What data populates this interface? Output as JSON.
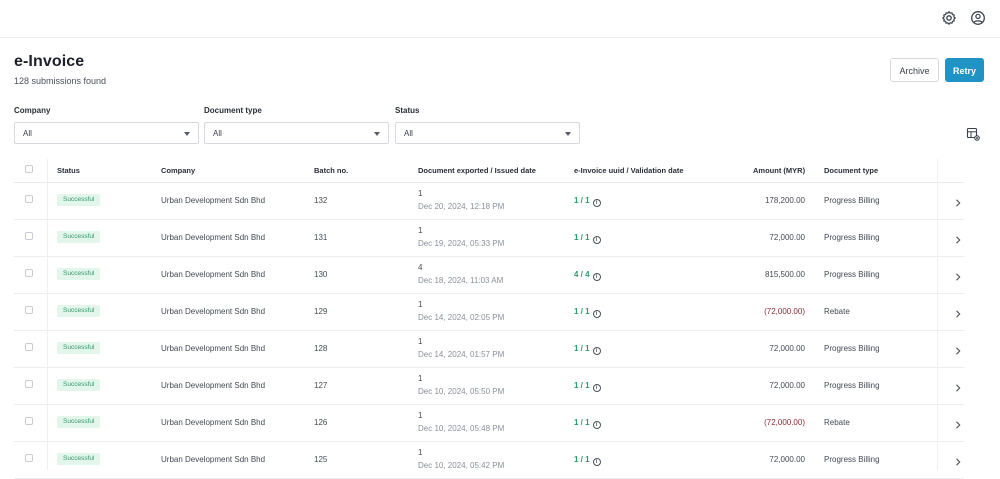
{
  "header": {
    "title": "e-Invoice",
    "subtitle": "128 submissions found",
    "archive_label": "Archive",
    "retry_label": "Retry",
    "accent_color": "#1f93c4"
  },
  "topbar": {
    "icons": [
      "gear-icon",
      "user-circle-icon"
    ]
  },
  "filters": {
    "company": {
      "label": "Company",
      "value": "All"
    },
    "document_type": {
      "label": "Document type",
      "value": "All"
    },
    "status": {
      "label": "Status",
      "value": "All"
    }
  },
  "table": {
    "columns": [
      "Status",
      "Company",
      "Batch no.",
      "Document exported / Issued date",
      "e-Invoice uuid / Validation date",
      "Amount (MYR)",
      "Document type"
    ],
    "rows": [
      {
        "status": "Successful",
        "company": "Urban Development Sdn Bhd",
        "batch": "132",
        "exported": "1",
        "date": "Dec 20, 2024, 12:18 PM",
        "uuid": "1 / 1",
        "amount": "178,200.00",
        "negative": false,
        "doc_type": "Progress Billing"
      },
      {
        "status": "Successful",
        "company": "Urban Development Sdn Bhd",
        "batch": "131",
        "exported": "1",
        "date": "Dec 19, 2024, 05:33 PM",
        "uuid": "1 / 1",
        "amount": "72,000.00",
        "negative": false,
        "doc_type": "Progress Billing"
      },
      {
        "status": "Successful",
        "company": "Urban Development Sdn Bhd",
        "batch": "130",
        "exported": "4",
        "date": "Dec 18, 2024, 11:03 AM",
        "uuid": "4 / 4",
        "amount": "815,500.00",
        "negative": false,
        "doc_type": "Progress Billing"
      },
      {
        "status": "Successful",
        "company": "Urban Development Sdn Bhd",
        "batch": "129",
        "exported": "1",
        "date": "Dec 14, 2024, 02:05 PM",
        "uuid": "1 / 1",
        "amount": "(72,000.00)",
        "negative": true,
        "doc_type": "Rebate"
      },
      {
        "status": "Successful",
        "company": "Urban Development Sdn Bhd",
        "batch": "128",
        "exported": "1",
        "date": "Dec 14, 2024, 01:57 PM",
        "uuid": "1 / 1",
        "amount": "72,000.00",
        "negative": false,
        "doc_type": "Progress Billing"
      },
      {
        "status": "Successful",
        "company": "Urban Development Sdn Bhd",
        "batch": "127",
        "exported": "1",
        "date": "Dec 10, 2024, 05:50 PM",
        "uuid": "1 / 1",
        "amount": "72,000.00",
        "negative": false,
        "doc_type": "Progress Billing"
      },
      {
        "status": "Successful",
        "company": "Urban Development Sdn Bhd",
        "batch": "126",
        "exported": "1",
        "date": "Dec 10, 2024, 05:48 PM",
        "uuid": "1 / 1",
        "amount": "(72,000.00)",
        "negative": true,
        "doc_type": "Rebate"
      },
      {
        "status": "Successful",
        "company": "Urban Development Sdn Bhd",
        "batch": "125",
        "exported": "1",
        "date": "Dec 10, 2024, 05:42 PM",
        "uuid": "1 / 1",
        "amount": "72,000.00",
        "negative": false,
        "doc_type": "Progress Billing"
      }
    ]
  }
}
